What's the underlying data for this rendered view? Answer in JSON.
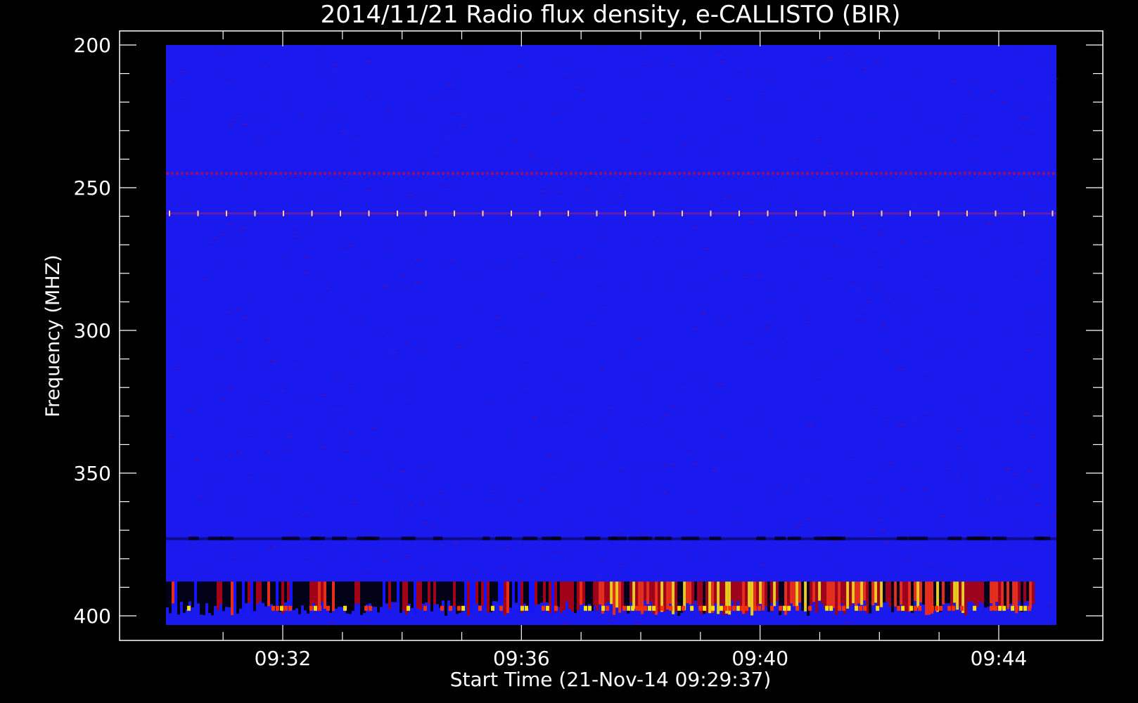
{
  "chart_data": {
    "type": "heatmap",
    "title": "2014/11/21  Radio flux density, e-CALLISTO (BIR)",
    "xlabel": "Start Time (21-Nov-14 09:29:37)",
    "ylabel": "Frequency (MHZ)",
    "x_range_minutes": [
      9.5,
      24.6
    ],
    "x_ticks": [
      {
        "value": 12,
        "label": "09:32"
      },
      {
        "value": 16,
        "label": "09:36"
      },
      {
        "value": 20,
        "label": "09:40"
      },
      {
        "value": 24,
        "label": "09:44"
      }
    ],
    "ylim": [
      200,
      405
    ],
    "y_ticks": [
      200,
      250,
      300,
      350,
      400
    ],
    "y_minor_step": 10,
    "colormap": [
      "#000000",
      "#1414ff",
      "#b00000",
      "#ff3000",
      "#ffe000"
    ],
    "background_color": "#1a1aee",
    "features": [
      {
        "kind": "band",
        "freq_mhz": 245,
        "intensity": "moderate",
        "note": "dashed interference line"
      },
      {
        "kind": "band",
        "freq_mhz": 259,
        "intensity": "strong",
        "note": "periodic spikes"
      },
      {
        "kind": "band",
        "freq_mhz": 373,
        "intensity": "dark",
        "note": "absorption line"
      },
      {
        "kind": "burst_region",
        "freq_range_mhz": [
          388,
          400
        ],
        "time_range_minutes": [
          9.5,
          17.2
        ],
        "intensity": "mixed dark/bright"
      },
      {
        "kind": "burst_region",
        "freq_range_mhz": [
          388,
          400
        ],
        "time_range_minutes": [
          17.2,
          24.6
        ],
        "intensity": "bright"
      }
    ]
  }
}
